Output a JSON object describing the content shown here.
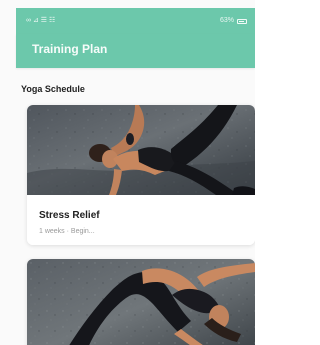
{
  "status_bar": {
    "left": "∞ ⊿ ☰ ☷",
    "right": "63%"
  },
  "header": {
    "title": "Training Plan"
  },
  "section": {
    "title": "Yoga Schedule"
  },
  "cards": [
    {
      "title": "Stress Relief",
      "subtitle": "1 weeks · Begin..."
    },
    {
      "title": "",
      "subtitle": ""
    }
  ],
  "colors": {
    "accent": "#6cc8ab",
    "background": "#fafafa",
    "card": "#ffffff"
  },
  "icons": {
    "status": "signal-wifi-battery-icons"
  }
}
